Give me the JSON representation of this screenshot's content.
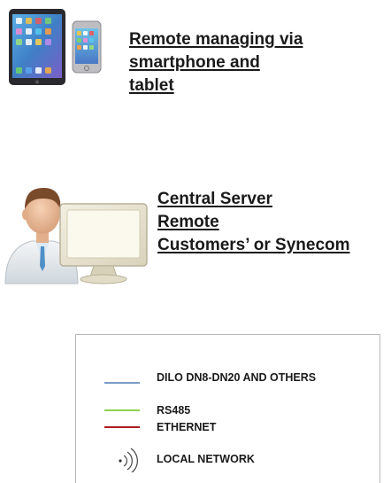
{
  "remote": {
    "line1": "Remote managing via",
    "line2": "smartphone and",
    "line3": "tablet"
  },
  "server": {
    "line1": "Central Server",
    "line2": "Remote",
    "line3": "Customers’ or Synecom"
  },
  "legend": {
    "items": [
      {
        "label": "DILO DN8-DN20 AND OTHERS",
        "color": "#7a9cc6"
      },
      {
        "label": "RS485",
        "color": "#8fd14f"
      },
      {
        "label": "ETHERNET",
        "color": "#b11c1c"
      },
      {
        "label": "LOCAL NETWORK",
        "icon": "wifi-signal-icon"
      }
    ]
  },
  "icons": {
    "devices": "tablet-and-smartphone-icon",
    "operator": "person-at-computer-icon"
  }
}
